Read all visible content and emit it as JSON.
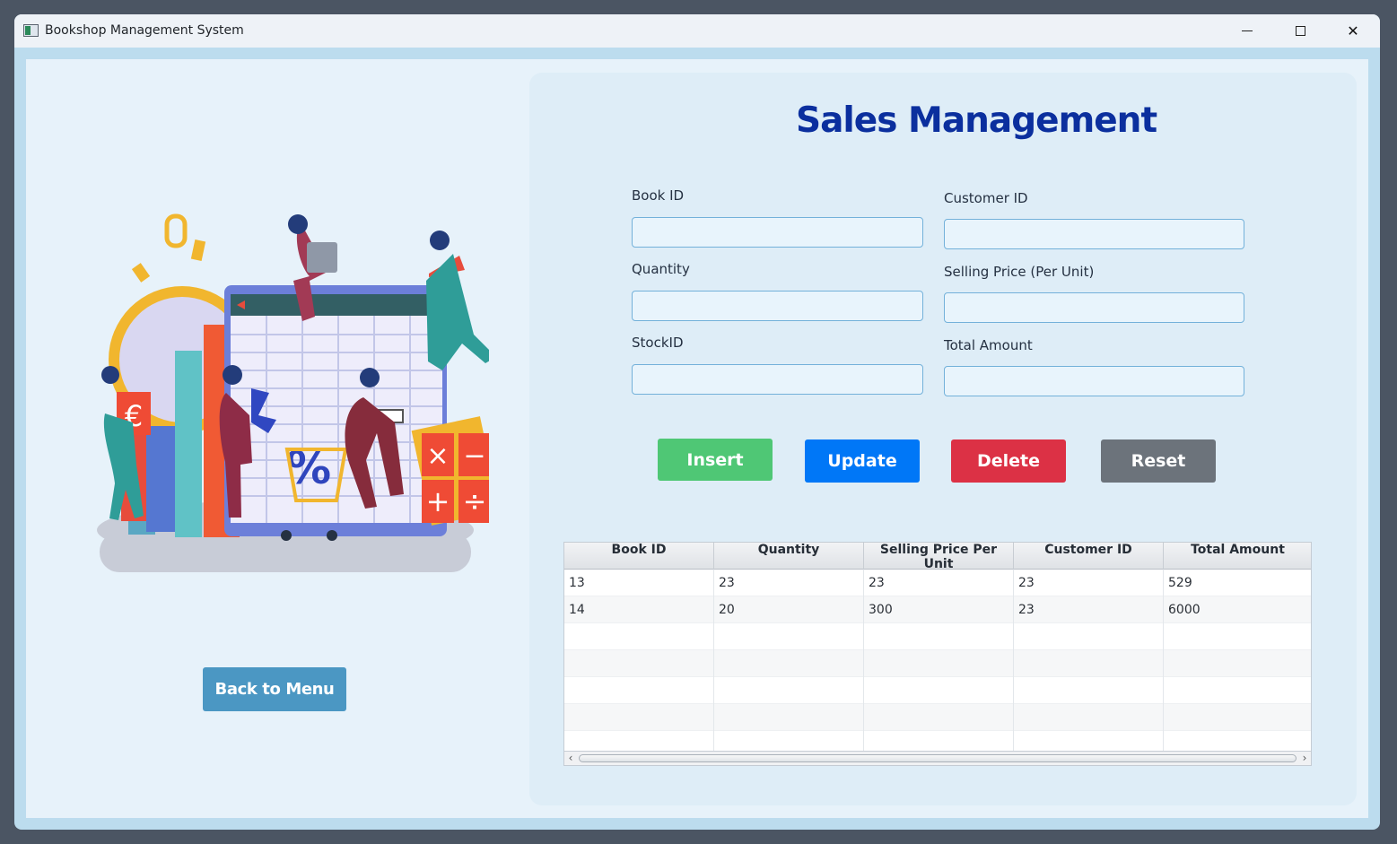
{
  "window": {
    "title": "Bookshop Management System",
    "controls": {
      "minimize": "—",
      "maximize": "□",
      "close": "✕"
    }
  },
  "left": {
    "illustration": {
      "icon": "sales-analytics-illustration",
      "symbols": [
        "€",
        "%",
        "×",
        "−",
        "+",
        "÷"
      ]
    },
    "back_button": "Back to Menu"
  },
  "form": {
    "heading": "Sales Management",
    "fields": {
      "book_id": {
        "label": "Book ID",
        "value": ""
      },
      "customer_id": {
        "label": "Customer ID",
        "value": ""
      },
      "quantity": {
        "label": "Quantity",
        "value": ""
      },
      "selling_price": {
        "label": "Selling Price (Per Unit)",
        "value": ""
      },
      "stock_id": {
        "label": "StockID",
        "value": ""
      },
      "total_amount": {
        "label": "Total Amount",
        "value": ""
      }
    },
    "buttons": {
      "insert": "Insert",
      "update": "Update",
      "delete": "Delete",
      "reset": "Reset"
    }
  },
  "table": {
    "columns": [
      "Book ID",
      "Quantity",
      "Selling Price Per Unit",
      "Customer ID",
      "Total Amount"
    ],
    "rows": [
      [
        "13",
        "23",
        "23",
        "23",
        "529"
      ],
      [
        "14",
        "20",
        "300",
        "23",
        "6000"
      ]
    ]
  },
  "colors": {
    "heading": "#0b2f9e",
    "insert": "#4fc775",
    "update": "#0077f7",
    "delete": "#dc3145",
    "reset": "#6c737b",
    "back": "#4b97c3"
  }
}
